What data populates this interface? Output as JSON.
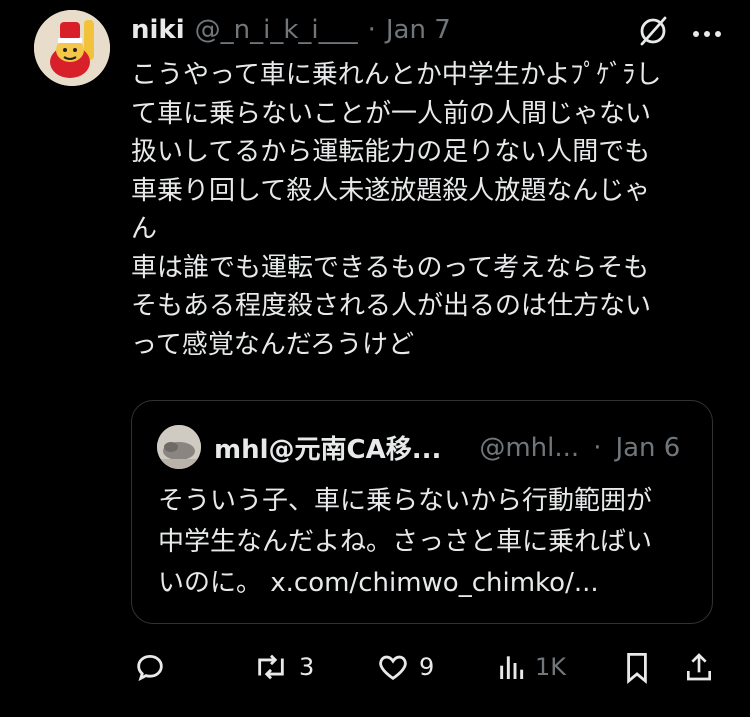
{
  "tweet": {
    "author_name": "niki",
    "handle": "@_n_i_k_i___",
    "separator": "·",
    "date": "Jan 7",
    "text": "こうやって車に乗れんとか中学生かよﾌﾟｹﾞﾗし\nて車に乗らないことが一人前の人間じゃない\n扱いしてるから運転能力の足りない人間でも\n車乗り回して殺人未遂放題殺人放題なんじゃ\nん\n車は誰でも運転できるものって考えならそも\nそもある程度殺される人が出るのは仕方ない\nって感覚なんだろうけど"
  },
  "quote": {
    "author_name": "mhl@元南CA移...",
    "handle": "@mhl...",
    "separator": "·",
    "date": "Jan 6",
    "text": "そういう子、車に乗らないから行動範囲が\n中学生なんだよね。さっさと車に乗ればい\nいのに。 x.com/chimwo_chimko/..."
  },
  "actions": {
    "reply_count": "",
    "repost_count": "3",
    "like_count": "9",
    "views_count": "1K"
  },
  "icons": {
    "top": [
      "grok-slash-icon",
      "more-icon"
    ],
    "actions": [
      "reply-icon",
      "repost-icon",
      "like-icon",
      "views-icon",
      "bookmark-icon",
      "share-icon"
    ]
  },
  "colors": {
    "background": "#000000",
    "text": "#e7e9ea",
    "muted": "#71767b",
    "border": "#2f3336"
  }
}
